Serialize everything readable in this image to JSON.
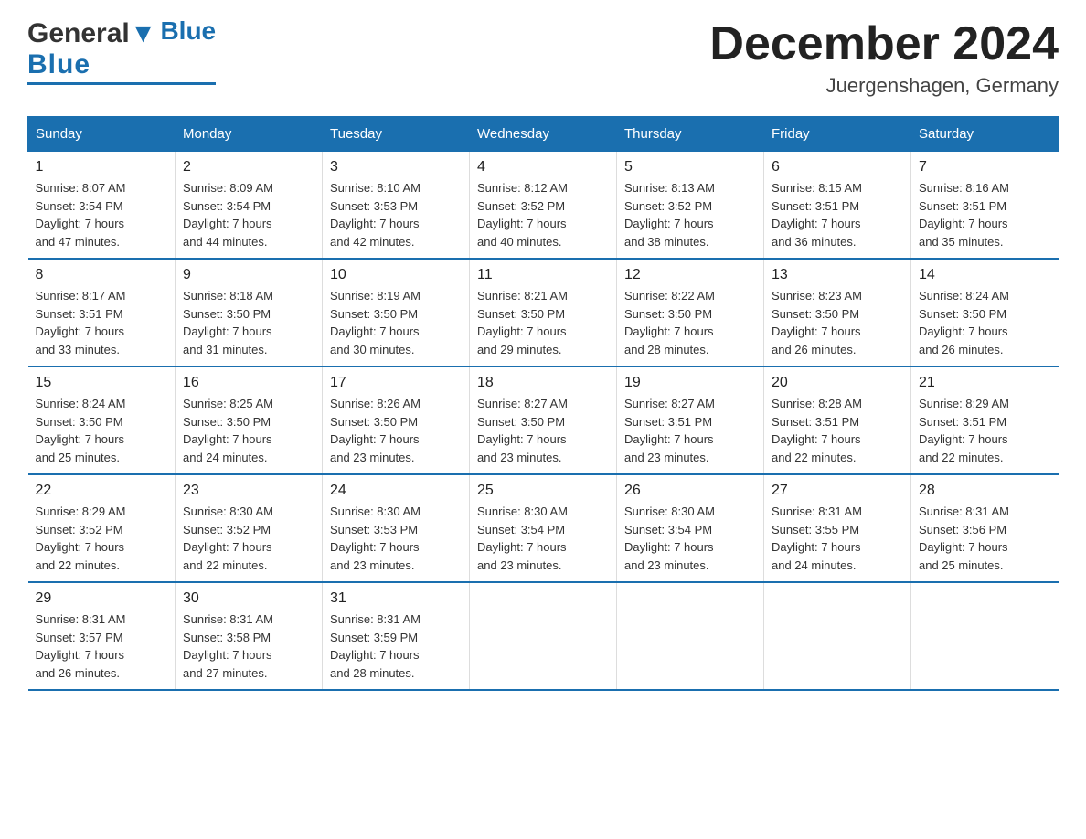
{
  "logo": {
    "general": "General",
    "blue": "Blue"
  },
  "header": {
    "month": "December 2024",
    "location": "Juergenshagen, Germany"
  },
  "days_of_week": [
    "Sunday",
    "Monday",
    "Tuesday",
    "Wednesday",
    "Thursday",
    "Friday",
    "Saturday"
  ],
  "weeks": [
    [
      {
        "day": "1",
        "sunrise": "8:07 AM",
        "sunset": "3:54 PM",
        "daylight": "7 hours and 47 minutes."
      },
      {
        "day": "2",
        "sunrise": "8:09 AM",
        "sunset": "3:54 PM",
        "daylight": "7 hours and 44 minutes."
      },
      {
        "day": "3",
        "sunrise": "8:10 AM",
        "sunset": "3:53 PM",
        "daylight": "7 hours and 42 minutes."
      },
      {
        "day": "4",
        "sunrise": "8:12 AM",
        "sunset": "3:52 PM",
        "daylight": "7 hours and 40 minutes."
      },
      {
        "day": "5",
        "sunrise": "8:13 AM",
        "sunset": "3:52 PM",
        "daylight": "7 hours and 38 minutes."
      },
      {
        "day": "6",
        "sunrise": "8:15 AM",
        "sunset": "3:51 PM",
        "daylight": "7 hours and 36 minutes."
      },
      {
        "day": "7",
        "sunrise": "8:16 AM",
        "sunset": "3:51 PM",
        "daylight": "7 hours and 35 minutes."
      }
    ],
    [
      {
        "day": "8",
        "sunrise": "8:17 AM",
        "sunset": "3:51 PM",
        "daylight": "7 hours and 33 minutes."
      },
      {
        "day": "9",
        "sunrise": "8:18 AM",
        "sunset": "3:50 PM",
        "daylight": "7 hours and 31 minutes."
      },
      {
        "day": "10",
        "sunrise": "8:19 AM",
        "sunset": "3:50 PM",
        "daylight": "7 hours and 30 minutes."
      },
      {
        "day": "11",
        "sunrise": "8:21 AM",
        "sunset": "3:50 PM",
        "daylight": "7 hours and 29 minutes."
      },
      {
        "day": "12",
        "sunrise": "8:22 AM",
        "sunset": "3:50 PM",
        "daylight": "7 hours and 28 minutes."
      },
      {
        "day": "13",
        "sunrise": "8:23 AM",
        "sunset": "3:50 PM",
        "daylight": "7 hours and 26 minutes."
      },
      {
        "day": "14",
        "sunrise": "8:24 AM",
        "sunset": "3:50 PM",
        "daylight": "7 hours and 26 minutes."
      }
    ],
    [
      {
        "day": "15",
        "sunrise": "8:24 AM",
        "sunset": "3:50 PM",
        "daylight": "7 hours and 25 minutes."
      },
      {
        "day": "16",
        "sunrise": "8:25 AM",
        "sunset": "3:50 PM",
        "daylight": "7 hours and 24 minutes."
      },
      {
        "day": "17",
        "sunrise": "8:26 AM",
        "sunset": "3:50 PM",
        "daylight": "7 hours and 23 minutes."
      },
      {
        "day": "18",
        "sunrise": "8:27 AM",
        "sunset": "3:50 PM",
        "daylight": "7 hours and 23 minutes."
      },
      {
        "day": "19",
        "sunrise": "8:27 AM",
        "sunset": "3:51 PM",
        "daylight": "7 hours and 23 minutes."
      },
      {
        "day": "20",
        "sunrise": "8:28 AM",
        "sunset": "3:51 PM",
        "daylight": "7 hours and 22 minutes."
      },
      {
        "day": "21",
        "sunrise": "8:29 AM",
        "sunset": "3:51 PM",
        "daylight": "7 hours and 22 minutes."
      }
    ],
    [
      {
        "day": "22",
        "sunrise": "8:29 AM",
        "sunset": "3:52 PM",
        "daylight": "7 hours and 22 minutes."
      },
      {
        "day": "23",
        "sunrise": "8:30 AM",
        "sunset": "3:52 PM",
        "daylight": "7 hours and 22 minutes."
      },
      {
        "day": "24",
        "sunrise": "8:30 AM",
        "sunset": "3:53 PM",
        "daylight": "7 hours and 23 minutes."
      },
      {
        "day": "25",
        "sunrise": "8:30 AM",
        "sunset": "3:54 PM",
        "daylight": "7 hours and 23 minutes."
      },
      {
        "day": "26",
        "sunrise": "8:30 AM",
        "sunset": "3:54 PM",
        "daylight": "7 hours and 23 minutes."
      },
      {
        "day": "27",
        "sunrise": "8:31 AM",
        "sunset": "3:55 PM",
        "daylight": "7 hours and 24 minutes."
      },
      {
        "day": "28",
        "sunrise": "8:31 AM",
        "sunset": "3:56 PM",
        "daylight": "7 hours and 25 minutes."
      }
    ],
    [
      {
        "day": "29",
        "sunrise": "8:31 AM",
        "sunset": "3:57 PM",
        "daylight": "7 hours and 26 minutes."
      },
      {
        "day": "30",
        "sunrise": "8:31 AM",
        "sunset": "3:58 PM",
        "daylight": "7 hours and 27 minutes."
      },
      {
        "day": "31",
        "sunrise": "8:31 AM",
        "sunset": "3:59 PM",
        "daylight": "7 hours and 28 minutes."
      },
      null,
      null,
      null,
      null
    ]
  ]
}
